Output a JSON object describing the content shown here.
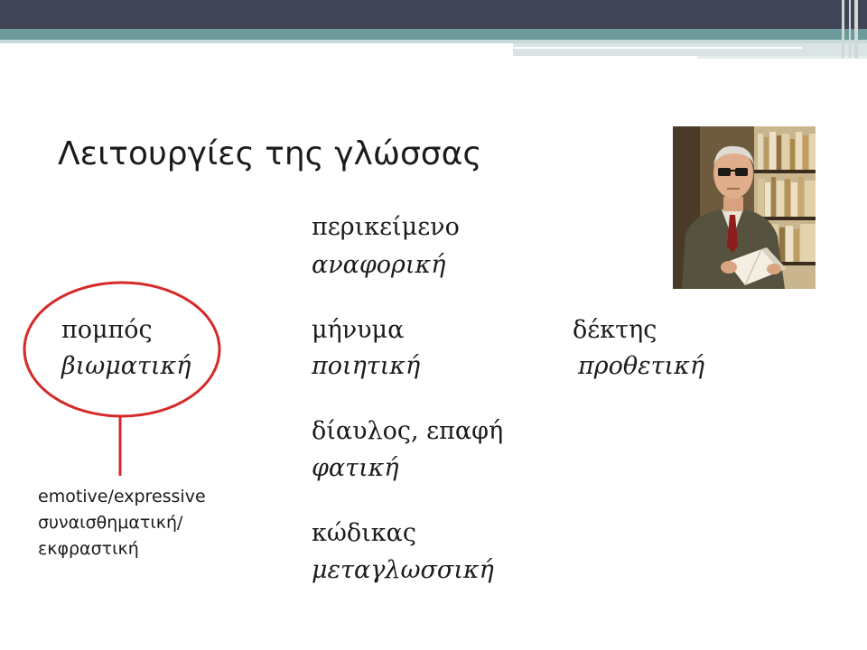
{
  "title": "Λειτουργίες της γλώσσας",
  "functions": {
    "context": {
      "term": "περικείμενο",
      "function": "αναφορική"
    },
    "sender": {
      "term": "πομπός",
      "function": "βιωματική"
    },
    "message": {
      "term": "μήνυμα",
      "function": "ποιητική"
    },
    "receiver": {
      "term": "δέκτης",
      "function": "προθετική"
    },
    "channel": {
      "term": "δίαυλος, επαφή",
      "function": "φατική"
    },
    "code": {
      "term": "κώδικας",
      "function": "μεταγλωσσική"
    }
  },
  "note": {
    "line1": "emotive/expressive",
    "line2": "συναισθηματική/",
    "line3": "εκφραστική"
  },
  "colors": {
    "header_dark": "#414455",
    "header_teal": "#6c9a9a",
    "annotation_red": "#d42a2a"
  }
}
